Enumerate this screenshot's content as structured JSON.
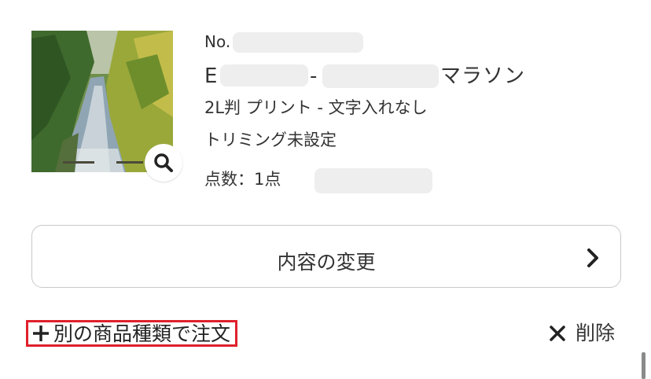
{
  "item": {
    "number_prefix": "No.",
    "title_prefix": "E",
    "title_separator": "-",
    "title_suffix": "マラソン",
    "spec": "2L判 プリント - 文字入れなし",
    "trimming": "トリミング未設定",
    "quantity": "点数：1点",
    "thumbnail_icon": "zoom-magnifier-icon"
  },
  "actions": {
    "change_label": "内容の変更",
    "add_other_label": "別の商品種類で注文",
    "delete_label": "削除"
  },
  "colors": {
    "text": "#333333",
    "border": "#c9c9c9",
    "highlight": "#e0202c",
    "redaction": "#eeeeee"
  }
}
